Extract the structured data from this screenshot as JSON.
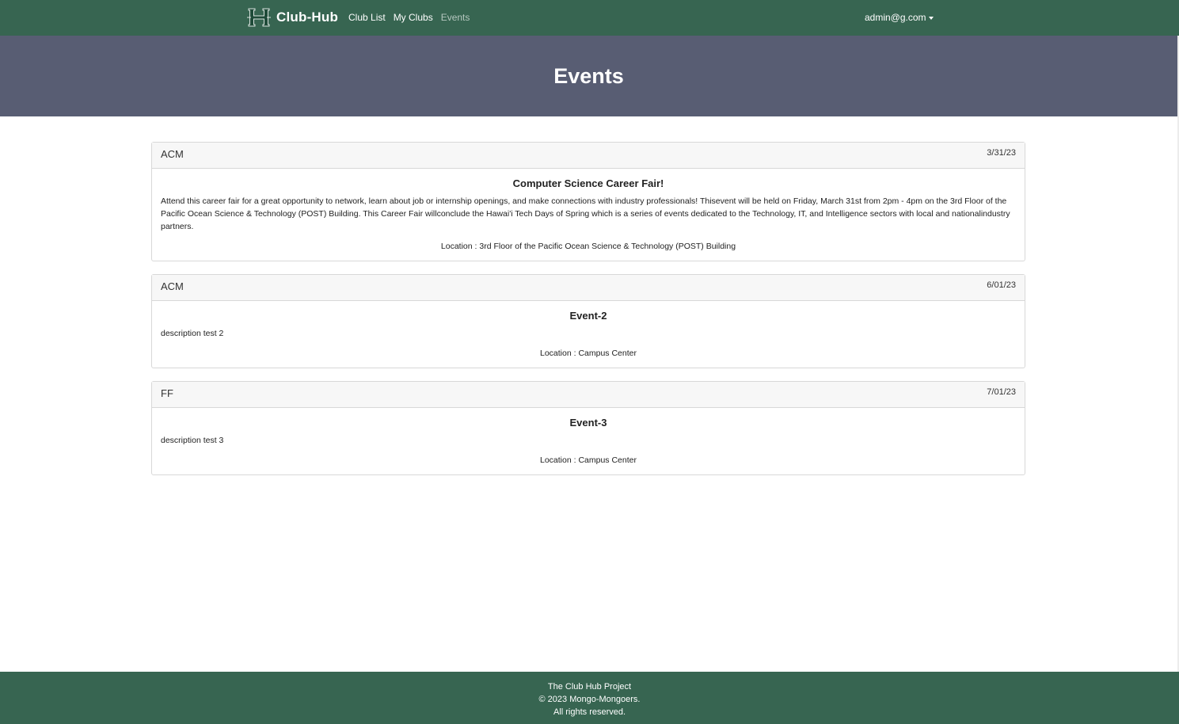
{
  "navbar": {
    "brand": "Club-Hub",
    "links": [
      {
        "label": "Club List",
        "active": false
      },
      {
        "label": "My Clubs",
        "active": false
      },
      {
        "label": "Events",
        "active": true
      }
    ],
    "user": "admin@g.com"
  },
  "hero": {
    "title": "Events"
  },
  "events": [
    {
      "club": "ACM",
      "date": "3/31/23",
      "title": "Computer Science Career Fair!",
      "description": "Attend this career fair for a great opportunity to network, learn about job or internship openings, and make connections with industry professionals! Thisevent will be held on Friday, March 31st from 2pm - 4pm on the 3rd Floor of the Pacific Ocean Science & Technology (POST) Building. This Career Fair willconclude the Hawai'i Tech Days of Spring which is a series of events dedicated to the Technology, IT, and Intelligence sectors with local and nationalindustry partners.",
      "location": "Location : 3rd Floor of the Pacific Ocean Science & Technology (POST) Building"
    },
    {
      "club": "ACM",
      "date": "6/01/23",
      "title": "Event-2",
      "description": "description test 2",
      "location": "Location : Campus Center"
    },
    {
      "club": "FF",
      "date": "7/01/23",
      "title": "Event-3",
      "description": "description test 3",
      "location": "Location : Campus Center"
    }
  ],
  "footer": {
    "line1": "The Club Hub Project",
    "line2": "© 2023 Mongo-Mongoers.",
    "line3": "All rights reserved."
  },
  "colors": {
    "navbar": "#376551",
    "hero": "#585d73",
    "footer": "#376551"
  },
  "icons": {
    "brand_logo": "uh-h-logo-icon",
    "user_caret": "caret-down-icon"
  }
}
